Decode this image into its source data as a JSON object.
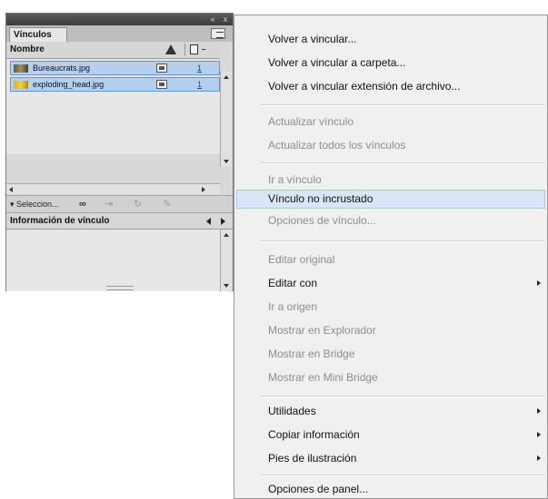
{
  "panel": {
    "tab_label": "Vínculos",
    "close_label": "x",
    "collapse_label": "«",
    "column_name": "Nombre",
    "rows": [
      {
        "name": "Bureaucrats.jpg",
        "page": "1"
      },
      {
        "name": "exploding_head.jpg",
        "page": "1"
      }
    ],
    "toolbar_label": "▾ Seleccion...",
    "info_title": "Información de vínculo"
  },
  "menu": {
    "items": [
      {
        "label": "Volver a vincular...",
        "enabled": true
      },
      {
        "label": "Volver a vincular a carpeta...",
        "enabled": true
      },
      {
        "label": "Volver a vincular extensión de archivo...",
        "enabled": true
      },
      {
        "label": "Actualizar vínculo",
        "enabled": false
      },
      {
        "label": "Actualizar todos los vínculos",
        "enabled": false
      },
      {
        "label": "Ir a vínculo",
        "enabled": false
      },
      {
        "label": "Vínculo no incrustado",
        "enabled": true,
        "highlighted": true
      },
      {
        "label": "Opciones de vínculo...",
        "enabled": false
      },
      {
        "label": "Editar original",
        "enabled": false
      },
      {
        "label": "Editar con",
        "enabled": true,
        "submenu": true
      },
      {
        "label": "Ir a origen",
        "enabled": false
      },
      {
        "label": "Mostrar en Explorador",
        "enabled": false
      },
      {
        "label": "Mostrar en Bridge",
        "enabled": false
      },
      {
        "label": "Mostrar en Mini Bridge",
        "enabled": false
      },
      {
        "label": "Utilidades",
        "enabled": true,
        "submenu": true
      },
      {
        "label": "Copiar información",
        "enabled": true,
        "submenu": true
      },
      {
        "label": "Pies de ilustración",
        "enabled": true,
        "submenu": true
      },
      {
        "label": "Opciones de panel...",
        "enabled": true
      }
    ]
  },
  "colors": {
    "selection_fill": "#b4cff0",
    "highlight_fill": "#d9e6f5",
    "disabled_text": "#8d8d8d",
    "page_link": "#1a3ec8"
  }
}
